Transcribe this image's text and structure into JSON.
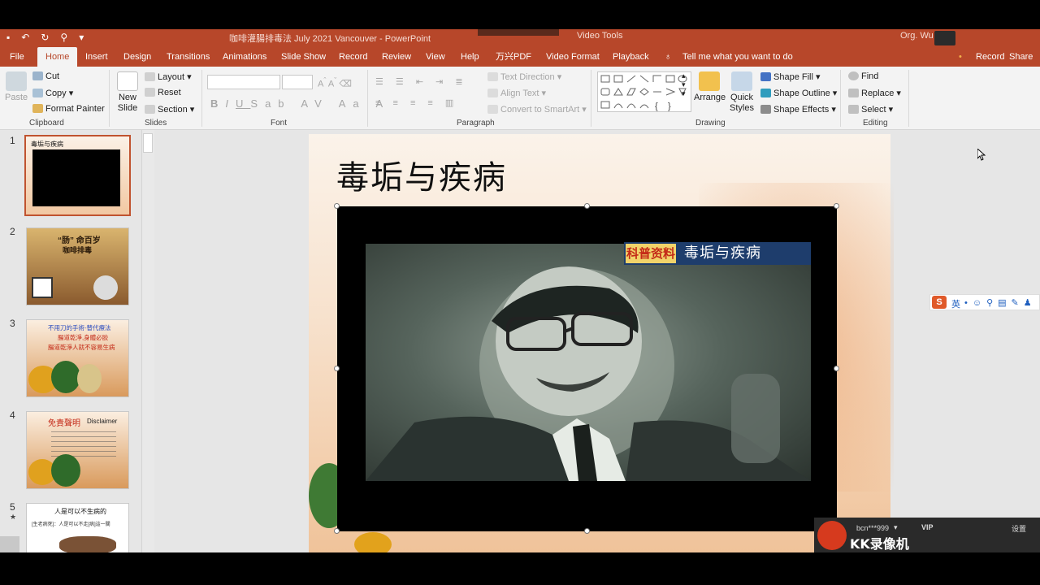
{
  "window": {
    "doc_title": "咖啡灌腸排毒法 July 2021 Vancouver - PowerPoint",
    "context_tab": "Video Tools",
    "user": "Org. Wu"
  },
  "tabs": [
    "File",
    "Home",
    "Insert",
    "Design",
    "Transitions",
    "Animations",
    "Slide Show",
    "Record",
    "Review",
    "View",
    "Help",
    "万兴PDF",
    "Video Format",
    "Playback"
  ],
  "tell_me": "Tell me what you want to do",
  "record_label": "Record",
  "share_label": "Share",
  "ribbon": {
    "clipboard": {
      "paste": "Paste",
      "cut": "Cut",
      "copy": "Copy",
      "format_painter": "Format Painter",
      "label": "Clipboard"
    },
    "slides": {
      "new_slide": "New Slide",
      "layout": "Layout",
      "reset": "Reset",
      "section": "Section",
      "label": "Slides"
    },
    "font": {
      "bold": "B",
      "italic": "I",
      "underline": "U",
      "strike": "S",
      "label": "Font"
    },
    "paragraph": {
      "text_direction": "Text Direction",
      "align_text": "Align Text",
      "convert": "Convert to SmartArt",
      "label": "Paragraph"
    },
    "drawing": {
      "arrange": "Arrange",
      "quick_styles": "Quick Styles",
      "shape_fill": "Shape Fill",
      "shape_outline": "Shape Outline",
      "shape_effects": "Shape Effects",
      "label": "Drawing"
    },
    "editing": {
      "find": "Find",
      "replace": "Replace",
      "select": "Select",
      "label": "Editing"
    }
  },
  "slides_panel": [
    {
      "num": "1",
      "title": "毒垢与疾病"
    },
    {
      "num": "2",
      "line1": "“肠” 命百岁",
      "line2": "咖啡排毒"
    },
    {
      "num": "3",
      "line1": "不用刀的手術-替代療法",
      "line2": "腸道乾淨,身體必胶",
      "line3": "腸道乾淨人就不容易生病"
    },
    {
      "num": "4",
      "line1": "免責聲明",
      "line2": "Disclaimer"
    },
    {
      "num": "5",
      "line1": "人是可以不生病的",
      "line2": "[生老病死]：人是可以不走[病]這一關"
    }
  ],
  "slide": {
    "title": "毒垢与疾病",
    "video_banner_tag": "科普资料",
    "video_banner_title": "毒垢与疾病"
  },
  "overlay": {
    "kk_user": "bcn***999",
    "kk_vip": "VIP",
    "kk_settings": "设置",
    "kk_brand": "KK录像机",
    "ime_lang": "英"
  }
}
